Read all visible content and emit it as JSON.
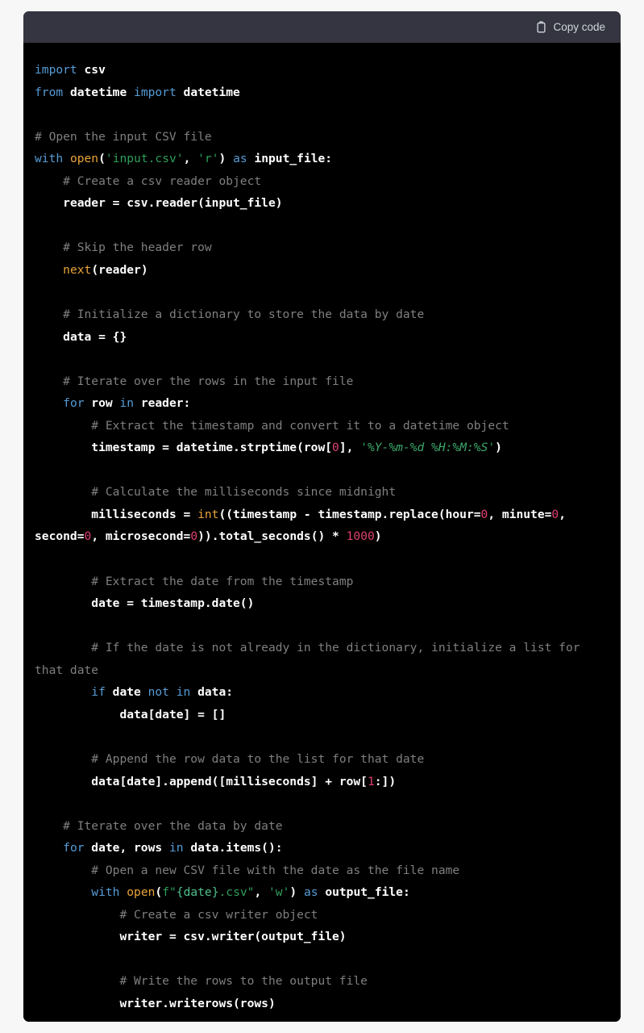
{
  "page": {
    "background_color": "#f7f7f8"
  },
  "code_block": {
    "header": {
      "background_color": "#343541",
      "copy_button_label": "Copy code",
      "copy_icon": "clipboard-icon"
    },
    "background_color": "#000000",
    "language": "python",
    "theme_colors": {
      "text": "#ffffff",
      "keyword": "#569cd6",
      "builtin": "#e9a33a",
      "string": "#2e9e5b",
      "number": "#e0416f",
      "comment": "#7f7f7f"
    },
    "lines": [
      [
        {
          "t": "import",
          "c": "kw"
        },
        {
          "t": " csv",
          "c": "plain"
        }
      ],
      [
        {
          "t": "from",
          "c": "kw"
        },
        {
          "t": " datetime ",
          "c": "plain"
        },
        {
          "t": "import",
          "c": "kw"
        },
        {
          "t": " datetime",
          "c": "plain"
        }
      ],
      [],
      [
        {
          "t": "# Open the input CSV file",
          "c": "com"
        }
      ],
      [
        {
          "t": "with",
          "c": "kw"
        },
        {
          "t": " ",
          "c": "plain"
        },
        {
          "t": "open",
          "c": "builtin"
        },
        {
          "t": "(",
          "c": "plain"
        },
        {
          "t": "'input.csv'",
          "c": "str"
        },
        {
          "t": ", ",
          "c": "plain"
        },
        {
          "t": "'r'",
          "c": "str"
        },
        {
          "t": ") ",
          "c": "plain"
        },
        {
          "t": "as",
          "c": "kw"
        },
        {
          "t": " input_file:",
          "c": "plain"
        }
      ],
      [
        {
          "t": "    # Create a csv reader object",
          "c": "com"
        }
      ],
      [
        {
          "t": "    reader = csv.reader(input_file)",
          "c": "plain"
        }
      ],
      [],
      [
        {
          "t": "    # Skip the header row",
          "c": "com"
        }
      ],
      [
        {
          "t": "    ",
          "c": "plain"
        },
        {
          "t": "next",
          "c": "builtin"
        },
        {
          "t": "(reader)",
          "c": "plain"
        }
      ],
      [],
      [
        {
          "t": "    # Initialize a dictionary to store the data by date",
          "c": "com"
        }
      ],
      [
        {
          "t": "    data = {}",
          "c": "plain"
        }
      ],
      [],
      [
        {
          "t": "    # Iterate over the rows in the input file",
          "c": "com"
        }
      ],
      [
        {
          "t": "    ",
          "c": "plain"
        },
        {
          "t": "for",
          "c": "kw"
        },
        {
          "t": " row ",
          "c": "plain"
        },
        {
          "t": "in",
          "c": "kw"
        },
        {
          "t": " reader:",
          "c": "plain"
        }
      ],
      [
        {
          "t": "        # Extract the timestamp and convert it to a datetime object",
          "c": "com"
        }
      ],
      [
        {
          "t": "        timestamp = datetime.strptime(row[",
          "c": "plain"
        },
        {
          "t": "0",
          "c": "num"
        },
        {
          "t": "], ",
          "c": "plain"
        },
        {
          "t": "'",
          "c": "str"
        },
        {
          "t": "%Y-%m-%d %H:%M:%S",
          "c": "str-fmt"
        },
        {
          "t": "'",
          "c": "str"
        },
        {
          "t": ")",
          "c": "plain"
        }
      ],
      [],
      [
        {
          "t": "        # Calculate the milliseconds since midnight",
          "c": "com"
        }
      ],
      [
        {
          "t": "        milliseconds = ",
          "c": "plain"
        },
        {
          "t": "int",
          "c": "builtin"
        },
        {
          "t": "((timestamp - timestamp.replace(hour=",
          "c": "plain"
        },
        {
          "t": "0",
          "c": "num"
        },
        {
          "t": ", minute=",
          "c": "plain"
        },
        {
          "t": "0",
          "c": "num"
        },
        {
          "t": ", second=",
          "c": "plain"
        },
        {
          "t": "0",
          "c": "num"
        },
        {
          "t": ", microsecond=",
          "c": "plain"
        },
        {
          "t": "0",
          "c": "num"
        },
        {
          "t": ")).total_seconds() * ",
          "c": "plain"
        },
        {
          "t": "1000",
          "c": "num"
        },
        {
          "t": ")",
          "c": "plain"
        }
      ],
      [],
      [
        {
          "t": "        # Extract the date from the timestamp",
          "c": "com"
        }
      ],
      [
        {
          "t": "        date = timestamp.date()",
          "c": "plain"
        }
      ],
      [],
      [
        {
          "t": "        # If the date is not already in the dictionary, initialize a list for that date",
          "c": "com"
        }
      ],
      [
        {
          "t": "        ",
          "c": "plain"
        },
        {
          "t": "if",
          "c": "kw"
        },
        {
          "t": " date ",
          "c": "plain"
        },
        {
          "t": "not",
          "c": "kw"
        },
        {
          "t": " ",
          "c": "plain"
        },
        {
          "t": "in",
          "c": "kw"
        },
        {
          "t": " data:",
          "c": "plain"
        }
      ],
      [
        {
          "t": "            data[date] = []",
          "c": "plain"
        }
      ],
      [],
      [
        {
          "t": "        # Append the row data to the list for that date",
          "c": "com"
        }
      ],
      [
        {
          "t": "        data[date].append([milliseconds] + row[",
          "c": "plain"
        },
        {
          "t": "1",
          "c": "num"
        },
        {
          "t": ":])",
          "c": "plain"
        }
      ],
      [],
      [
        {
          "t": "    # Iterate over the data by date",
          "c": "com"
        }
      ],
      [
        {
          "t": "    ",
          "c": "plain"
        },
        {
          "t": "for",
          "c": "kw"
        },
        {
          "t": " date, rows ",
          "c": "plain"
        },
        {
          "t": "in",
          "c": "kw"
        },
        {
          "t": " data.items():",
          "c": "plain"
        }
      ],
      [
        {
          "t": "        # Open a new CSV file with the date as the file name",
          "c": "com"
        }
      ],
      [
        {
          "t": "        ",
          "c": "plain"
        },
        {
          "t": "with",
          "c": "kw"
        },
        {
          "t": " ",
          "c": "plain"
        },
        {
          "t": "open",
          "c": "builtin"
        },
        {
          "t": "(",
          "c": "plain"
        },
        {
          "t": "f\"",
          "c": "str"
        },
        {
          "t": "{date}",
          "c": "fstr-br"
        },
        {
          "t": ".csv\"",
          "c": "str"
        },
        {
          "t": ", ",
          "c": "plain"
        },
        {
          "t": "'w'",
          "c": "str"
        },
        {
          "t": ") ",
          "c": "plain"
        },
        {
          "t": "as",
          "c": "kw"
        },
        {
          "t": " output_file:",
          "c": "plain"
        }
      ],
      [
        {
          "t": "            # Create a csv writer object",
          "c": "com"
        }
      ],
      [
        {
          "t": "            writer = csv.writer(output_file)",
          "c": "plain"
        }
      ],
      [],
      [
        {
          "t": "            # Write the rows to the output file",
          "c": "com"
        }
      ],
      [
        {
          "t": "            writer.writerows(rows)",
          "c": "plain"
        }
      ]
    ]
  }
}
